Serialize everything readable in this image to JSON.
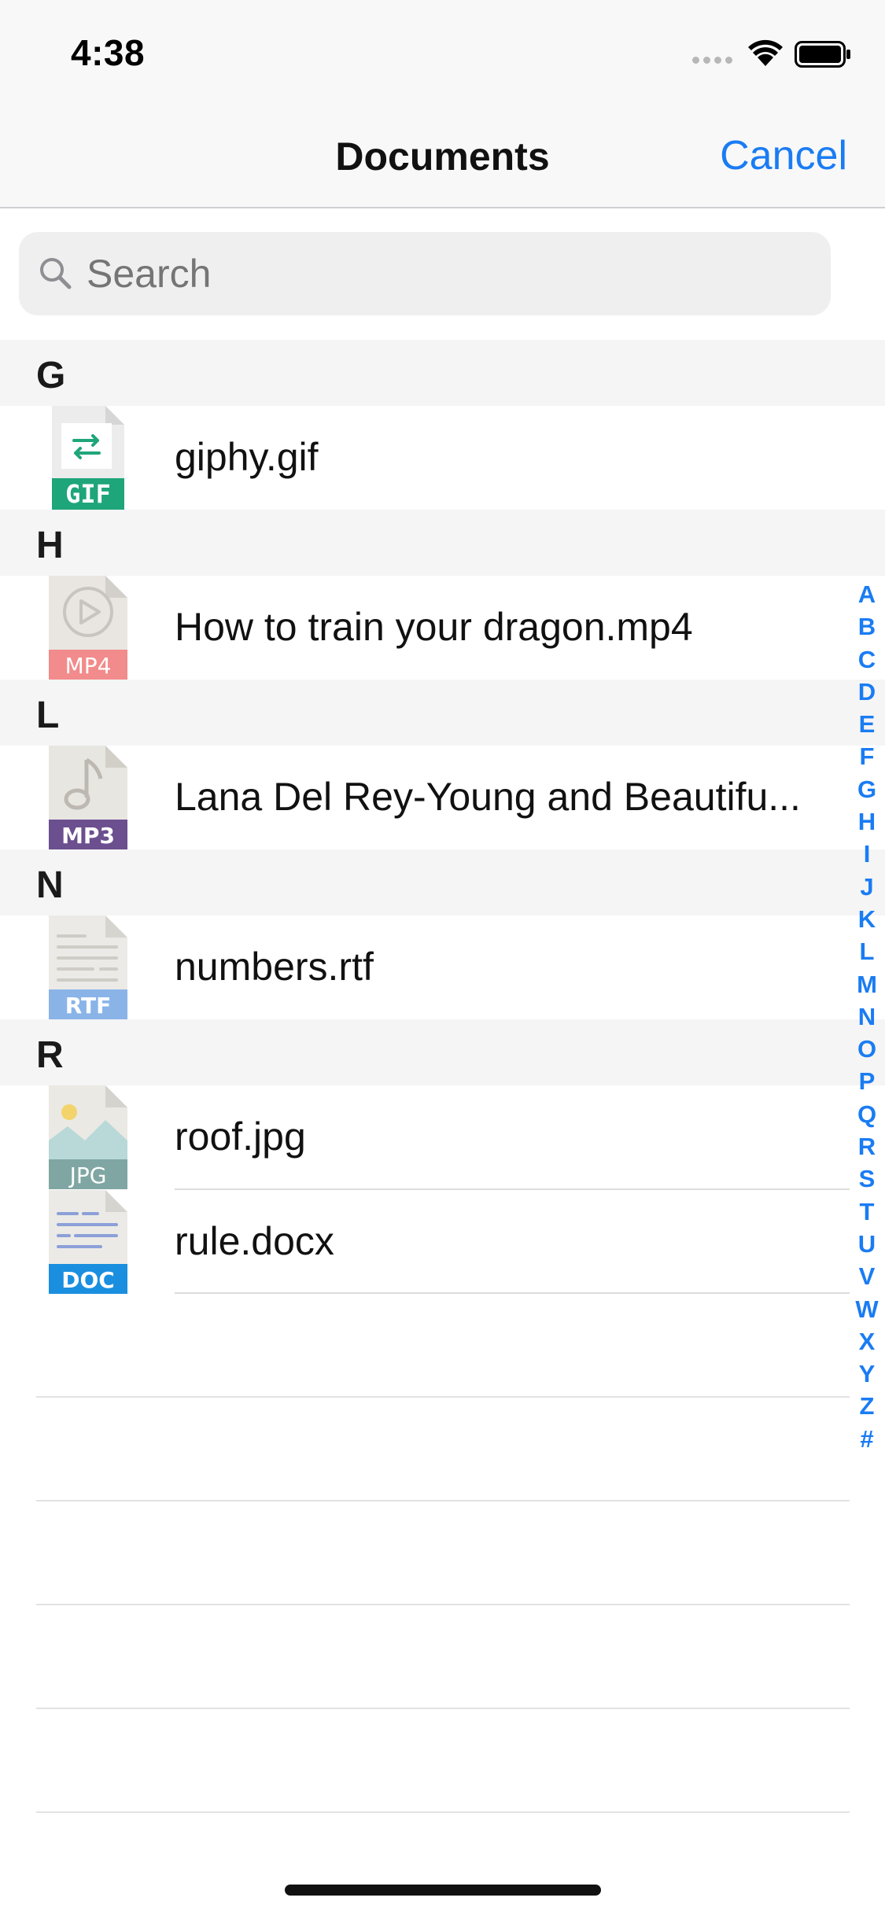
{
  "status_bar": {
    "time": "4:38"
  },
  "nav": {
    "title": "Documents",
    "cancel_label": "Cancel"
  },
  "search": {
    "placeholder": "Search"
  },
  "sections": [
    {
      "letter": "G",
      "files": [
        {
          "name": "giphy.gif",
          "type": "GIF",
          "icon": "gif-file-icon",
          "color": "#1fa57a"
        }
      ]
    },
    {
      "letter": "H",
      "files": [
        {
          "name": "How to train your dragon.mp4",
          "type": "MP4",
          "icon": "mp4-file-icon",
          "color": "#f28b8b"
        }
      ]
    },
    {
      "letter": "L",
      "files": [
        {
          "name": "Lana Del Rey-Young and Beautifu...",
          "type": "MP3",
          "icon": "mp3-file-icon",
          "color": "#6b4f8f"
        }
      ]
    },
    {
      "letter": "N",
      "files": [
        {
          "name": "numbers.rtf",
          "type": "RTF",
          "icon": "rtf-file-icon",
          "color": "#8ab4e8"
        }
      ]
    },
    {
      "letter": "R",
      "files": [
        {
          "name": "roof.jpg",
          "type": "JPG",
          "icon": "jpg-file-icon",
          "color": "#7fa6a2"
        },
        {
          "name": "rule.docx",
          "type": "DOC",
          "icon": "doc-file-icon",
          "color": "#1a8fe0"
        }
      ]
    }
  ],
  "index_letters": [
    "A",
    "B",
    "C",
    "D",
    "E",
    "F",
    "G",
    "H",
    "I",
    "J",
    "K",
    "L",
    "M",
    "N",
    "O",
    "P",
    "Q",
    "R",
    "S",
    "T",
    "U",
    "V",
    "W",
    "X",
    "Y",
    "Z",
    "#"
  ],
  "colors": {
    "accent": "#1a7cf3",
    "header_bg": "#f5f5f5"
  }
}
